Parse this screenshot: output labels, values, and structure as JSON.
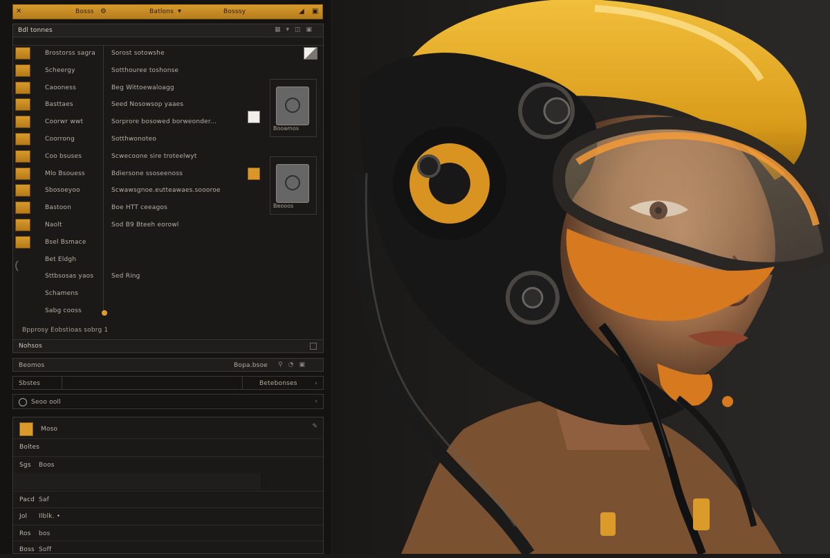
{
  "toolbar": {
    "item1": "Bosss",
    "item2": "Batlons",
    "item3": "Bosssy"
  },
  "main_panel": {
    "title": "Bdl tonnes",
    "rows": [
      {
        "name": "Brostorss sagra",
        "desc": "Sorost sotowshe"
      },
      {
        "name": "Scheergy",
        "desc": "Sotthouree toshonse"
      },
      {
        "name": "Caooness",
        "desc": "Beg Wittoewaloagg"
      },
      {
        "name": "Basttaes",
        "desc": "Seed Nosowsop yaaes"
      },
      {
        "name": "Coorwr wwt",
        "desc": "Sorprore bosowed borweonder..."
      },
      {
        "name": "Coorrong",
        "desc": "Sotthwonoteo"
      },
      {
        "name": "Coo bsuses",
        "desc": "Scwecoone sire troteelwyt"
      },
      {
        "name": "Mlo Bsouess",
        "desc": "Bdiersone ssoseenoss"
      },
      {
        "name": "Sbosoeyoo",
        "desc": "Scwawsgnoe.eutteawaes.soooroe"
      },
      {
        "name": "Bastoon",
        "desc": "Boe HTT ceeagos"
      },
      {
        "name": "Naolt",
        "desc": "Sod B9 Bteeh eorowl"
      },
      {
        "name": "Bsel Bsmace",
        "desc": ""
      },
      {
        "name": "Bet Eldgh",
        "desc": ""
      },
      {
        "name": "Sttbsosas yaos",
        "desc": "Sed Ring"
      },
      {
        "name": "Schamens",
        "desc": ""
      },
      {
        "name": "Sabg cooss",
        "desc": ""
      }
    ],
    "footer": "Bpprosy Eobstioas sobrg 1",
    "bottom_label": "Nohsos",
    "card1_caption": "Booamos",
    "card2_caption": "Beooos"
  },
  "lower": {
    "bar1_left": "Beomos",
    "bar1_mid": "Bopa.bsoe",
    "bar2_left": "Sbstes",
    "bar2_mid": "Betebonses",
    "bar3_left": "Seoo ooll",
    "logo_label": "Moso",
    "rows": [
      {
        "k": "Boltes",
        "v": ""
      },
      {
        "k": "Sgs",
        "v": "Boos"
      },
      {
        "k": "Pacd",
        "v": "Saf"
      },
      {
        "k": "Jol",
        "v": "Ilblk. •"
      },
      {
        "k": "Ros",
        "v": "bos"
      },
      {
        "k": "Boss",
        "v": "Soff"
      }
    ]
  }
}
